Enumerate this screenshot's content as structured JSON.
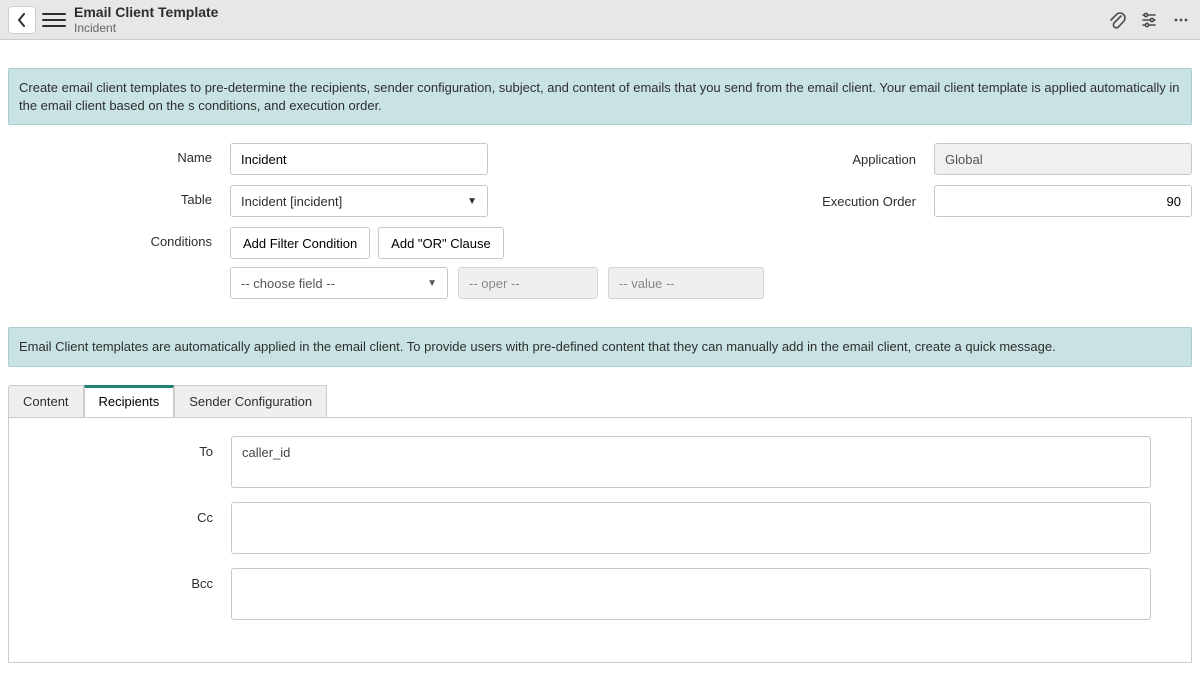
{
  "header": {
    "title": "Email Client Template",
    "subtitle": "Incident"
  },
  "banners": {
    "top": "Create email client templates to pre-determine the recipients, sender configuration, subject, and content of emails that you send from the email client. Your email client template is applied automatically in the email client based on the s conditions, and execution order.",
    "mid": "Email Client templates are automatically applied in the email client. To provide users with pre-defined content that they can manually add in the email client, create a quick message."
  },
  "form": {
    "labels": {
      "name": "Name",
      "table": "Table",
      "conditions": "Conditions",
      "application": "Application",
      "execution_order": "Execution Order"
    },
    "name_value": "Incident",
    "table_value": "Incident [incident]",
    "application_value": "Global",
    "execution_order_value": "90",
    "cond_add_filter": "Add Filter Condition",
    "cond_add_or": "Add \"OR\" Clause",
    "cond_choose_field": "-- choose field --",
    "cond_oper": "-- oper --",
    "cond_value": "-- value --"
  },
  "tabs": {
    "content": "Content",
    "recipients": "Recipients",
    "sender": "Sender Configuration"
  },
  "recipients": {
    "to_label": "To",
    "to_value": "caller_id",
    "cc_label": "Cc",
    "cc_value": "",
    "bcc_label": "Bcc",
    "bcc_value": ""
  }
}
